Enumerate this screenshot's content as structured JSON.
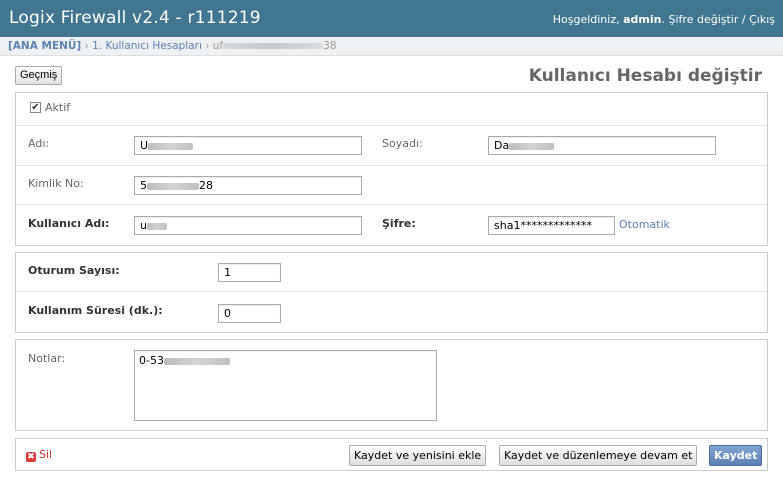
{
  "header": {
    "brand": "Logix Firewall v2.4 - r111219",
    "welcome": "Hoşgeldiniz,",
    "username": "admin",
    "separator1": ".",
    "change_password": "Şifre değiştir",
    "separator2": "/",
    "logout": "Çıkış"
  },
  "breadcrumbs": {
    "home": "[ANA MENÜ]",
    "sep1": "›",
    "section": "1. Kullanıcı Hesapları",
    "sep2": "›",
    "current_prefix": "uf",
    "current_suffix": "38"
  },
  "toolbar": {
    "history_label": "Geçmiş"
  },
  "page_title": "Kullanıcı Hesabı değiştir",
  "form": {
    "active_label": "Aktif",
    "active_checked": true,
    "first_name_label": "Adı:",
    "first_name_value": "U",
    "last_name_label": "Soyadı:",
    "last_name_value": "Da",
    "id_no_label": "Kimlik No:",
    "id_no_prefix": "5",
    "id_no_suffix": "28",
    "username_label": "Kullanıcı Adı:",
    "username_value": "u",
    "password_label": "Şifre:",
    "password_value": "sha1*************",
    "auto_link": "Otomatik",
    "session_count_label": "Oturum Sayısı:",
    "session_count_value": "1",
    "usage_time_label": "Kullanım Süresi (dk.):",
    "usage_time_value": "0",
    "notes_label": "Notlar:",
    "notes_value": "0-53"
  },
  "actions": {
    "delete_label": "Sil",
    "save_add_another": "Kaydet ve yenisini ekle",
    "save_continue": "Kaydet ve düzenlemeye devam et",
    "save": "Kaydet"
  },
  "colors": {
    "header_bg": "#417690",
    "link": "#5b80b2",
    "delete": "#cc3434",
    "primary_button": "#5b80b2"
  }
}
